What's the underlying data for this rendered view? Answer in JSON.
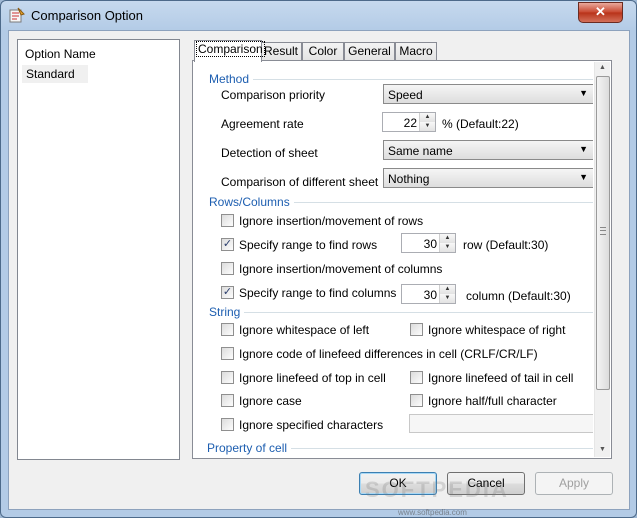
{
  "window": {
    "title": "Comparison Option",
    "close_glyph": "✕"
  },
  "sidebar": {
    "header": "Option Name",
    "items": [
      {
        "label": "Standard"
      }
    ]
  },
  "tabs": [
    {
      "label": "Comparison",
      "active": true
    },
    {
      "label": "Result"
    },
    {
      "label": "Color"
    },
    {
      "label": "General"
    },
    {
      "label": "Macro"
    }
  ],
  "method": {
    "heading": "Method",
    "comparison_priority_label": "Comparison priority",
    "comparison_priority_value": "Speed",
    "agreement_rate_label": "Agreement rate",
    "agreement_rate_value": "22",
    "agreement_rate_default": "% (Default:22)",
    "detection_label": "Detection of sheet",
    "detection_value": "Same name",
    "diff_sheet_label": "Comparison of different sheet",
    "diff_sheet_value": "Nothing"
  },
  "rows_columns": {
    "heading": "Rows/Columns",
    "ignore_rows_label": "Ignore insertion/movement of rows",
    "ignore_rows_checked": false,
    "range_rows_label": "Specify range to find rows",
    "range_rows_checked": true,
    "range_rows_value": "30",
    "range_rows_default": "row (Default:30)",
    "ignore_cols_label": "Ignore insertion/movement of columns",
    "ignore_cols_checked": false,
    "range_cols_label": "Specify range to find columns",
    "range_cols_checked": true,
    "range_cols_value": "30",
    "range_cols_default": "column (Default:30)"
  },
  "string": {
    "heading": "String",
    "ws_left": "Ignore whitespace of left",
    "ws_right": "Ignore whitespace of right",
    "linefeed_diff": "Ignore code of linefeed differences in cell (CRLF/CR/LF)",
    "lf_top": "Ignore linefeed of top in cell",
    "lf_tail": "Ignore linefeed of tail in cell",
    "case": "Ignore case",
    "half_full": "Ignore half/full character",
    "specified_chars": "Ignore specified characters",
    "specified_chars_value": ""
  },
  "property": {
    "heading": "Property of cell"
  },
  "buttons": {
    "ok": "OK",
    "cancel": "Cancel",
    "apply": "Apply"
  },
  "watermark": {
    "text": "SOFTPEDIA",
    "url": "www.softpedia.com"
  },
  "icons": {
    "check": "✓",
    "caret_down": "▼",
    "spin_up": "▲",
    "spin_down": "▼"
  }
}
